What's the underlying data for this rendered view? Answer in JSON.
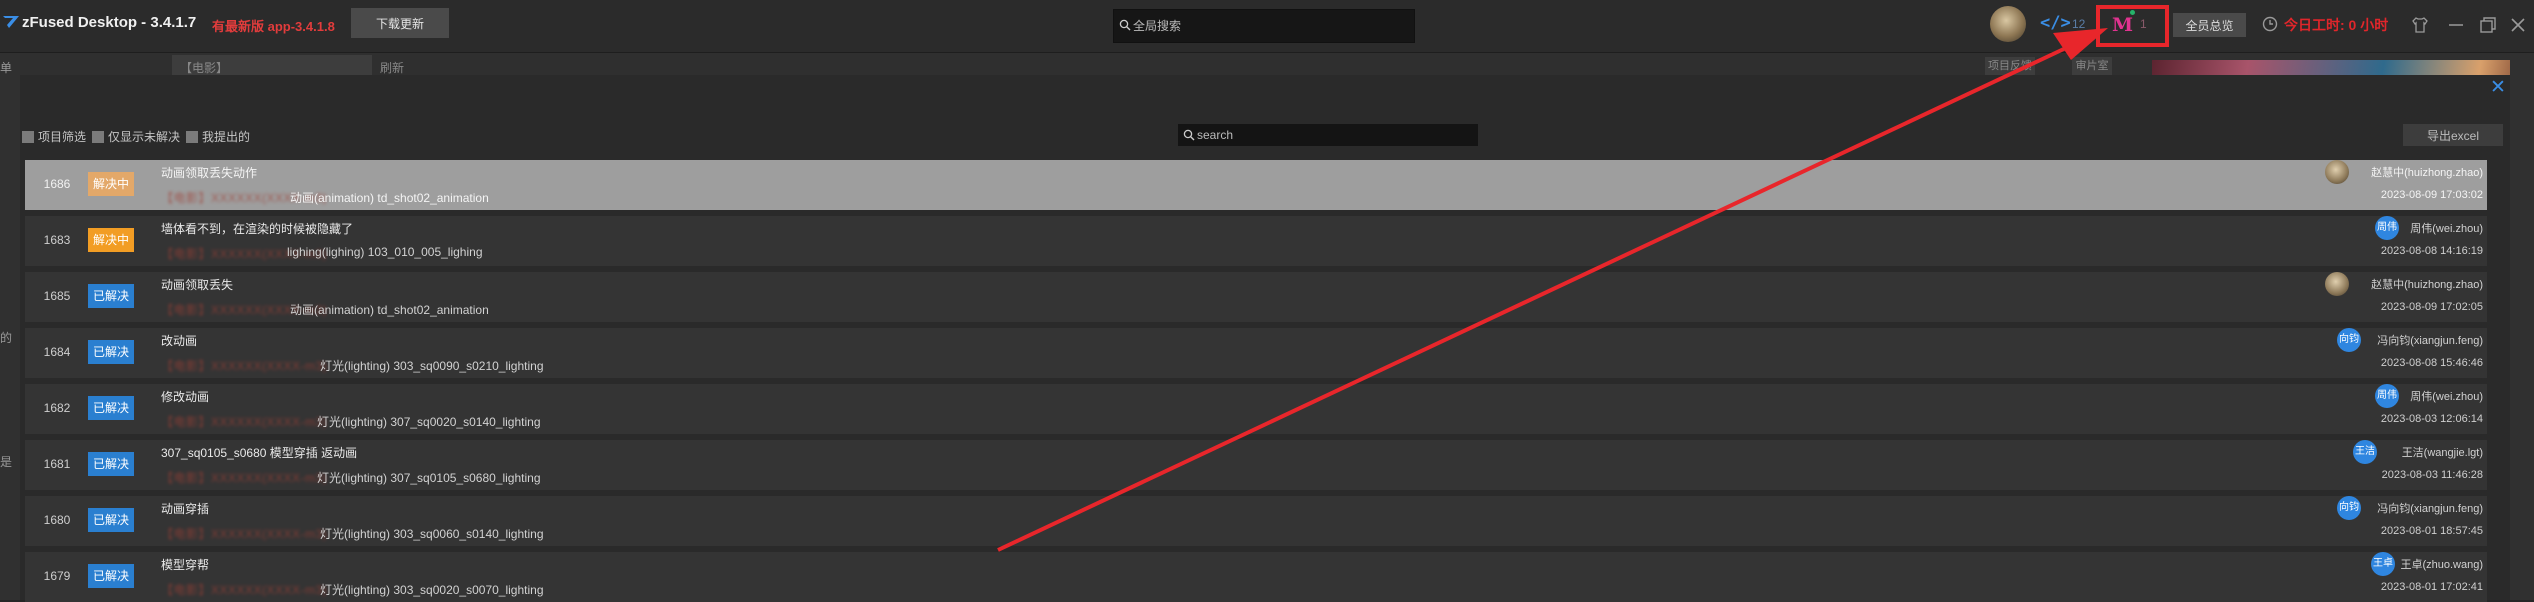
{
  "app": {
    "title": "zFused Desktop - 3.4.1.7",
    "new_version_text": "有最新版 app-3.4.1.8",
    "download_label": "下载更新"
  },
  "global_search": {
    "placeholder": "全局搜索"
  },
  "toolbar": {
    "code_count": "12",
    "m_count": "1",
    "overview_label": "全员总览",
    "worktime": "今日工时: 0 小时"
  },
  "background": {
    "tab_text": "【电影】",
    "refresh_label": "刷新",
    "btn1": "项目反馈",
    "btn2": "审片室",
    "left_labels": [
      "单",
      "的",
      "是"
    ]
  },
  "panel": {
    "filters": [
      {
        "label": "项目筛选"
      },
      {
        "label": "仅显示未解决"
      },
      {
        "label": "我提出的"
      }
    ],
    "search_placeholder": "search",
    "export_label": "导出excel"
  },
  "rows": [
    {
      "id": "1686",
      "status": "解决中",
      "title": "动画领取丢失动作",
      "project": "【电影】XXXXXX(XXXX-m3)",
      "step": "动画(animation)   td_shot02_animation",
      "avatar": "",
      "user": "赵慧中(huizhong.zhao)",
      "time": "2023-08-09 17:03:02"
    },
    {
      "id": "1683",
      "status": "解决中",
      "title": "墙体看不到，在渲染的时候被隐藏了",
      "project": "【电影】XXXXXX(XXXX-m3)",
      "step": "lighing(lighing)   103_010_005_lighing",
      "avatar": "周伟",
      "user": "周伟(wei.zhou)",
      "time": "2023-08-08 14:16:19"
    },
    {
      "id": "1685",
      "status": "已解决",
      "title": "动画领取丢失",
      "project": "【电影】XXXXXX(XXXX-m3)",
      "step": "动画(animation)   td_shot02_animation",
      "avatar": "",
      "user": "赵慧中(huizhong.zhao)",
      "time": "2023-08-09 17:02:05"
    },
    {
      "id": "1684",
      "status": "已解决",
      "title": "改动画",
      "project": "【电影】XXXXXX(XXXX-m3)",
      "step": "灯光(lighting)   303_sq0090_s0210_lighting",
      "avatar": "向钧",
      "user": "冯向钧(xiangjun.feng)",
      "time": "2023-08-08 15:46:46"
    },
    {
      "id": "1682",
      "status": "已解决",
      "title": "修改动画",
      "project": "【电影】XXXXXX(XXXX-m3)",
      "step": "灯光(lighting)   307_sq0020_s0140_lighting",
      "avatar": "周伟",
      "user": "周伟(wei.zhou)",
      "time": "2023-08-03 12:06:14"
    },
    {
      "id": "1681",
      "status": "已解决",
      "title": "307_sq0105_s0680 模型穿插 返动画",
      "project": "【电影】XXXXXX(XXXX-m3)",
      "step": "灯光(lighting)   307_sq0105_s0680_lighting",
      "avatar": "王洁",
      "user": "王洁(wangjie.lgt)",
      "time": "2023-08-03 11:46:28"
    },
    {
      "id": "1680",
      "status": "已解决",
      "title": "动画穿插",
      "project": "【电影】XXXXXX(XXXX-m3)",
      "step": "灯光(lighting)   303_sq0060_s0140_lighting",
      "avatar": "向钧",
      "user": "冯向钧(xiangjun.feng)",
      "time": "2023-08-01 18:57:45"
    },
    {
      "id": "1679",
      "status": "已解决",
      "title": "模型穿帮",
      "project": "【电影】XXXXXX(XXXX-m3)",
      "step": "灯光(lighting)   303_sq0020_s0070_lighting",
      "avatar": "王卓",
      "user": "王卓(zhuo.wang)",
      "time": "2023-08-01 17:02:41"
    }
  ],
  "colors": {
    "resolving": "#f29d24",
    "resolving_selected": "#e3a869",
    "resolved": "#2a7fd0",
    "accent_red": "#e8262b",
    "avatar_blue": "#2f86e0"
  }
}
